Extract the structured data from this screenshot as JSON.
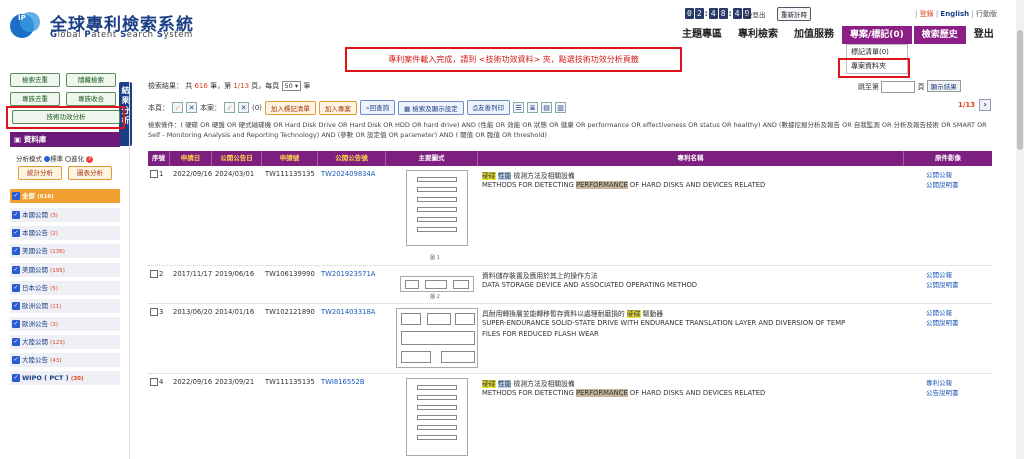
{
  "header": {
    "title_zh": "全球專利檢索系統",
    "title_en_words": [
      "G",
      "lobal ",
      "P",
      "atent ",
      "S",
      "earch ",
      "S",
      "ystem"
    ],
    "timer_digits": [
      "0",
      "2",
      "4",
      "8",
      "4",
      "9"
    ],
    "after_logout": "後登出",
    "reset_timer": "重新計時",
    "links": {
      "sep1": "|",
      "login": "登錄",
      "sep2": "|",
      "english": "English",
      "sep3": "|",
      "mobile": "行動版"
    }
  },
  "nav": {
    "items": [
      "主題專區",
      "專利檢索",
      "加值服務",
      "專案/標記(0)",
      "檢索歷史",
      "登出"
    ]
  },
  "dropdown": {
    "items": [
      "標記清單(0)",
      "專案資料夾"
    ]
  },
  "notice": "專利案件載入完成，請到 <技術功效資料> 夾，點選技術功效分析頁籤",
  "sidebar": {
    "buttons": [
      "檢索去重",
      "隱藏檢索",
      "專族去重",
      "專族收合"
    ],
    "tab_label": "結果分析",
    "tech_button": "技術功效分析",
    "db_title": "資料庫",
    "analysis_mode": {
      "label": "分析模式",
      "opt1": "標準",
      "opt2": "進化"
    },
    "stat_btn": "統計分析",
    "chart_btn": "圖表分析",
    "databases": [
      {
        "name": "全部",
        "count": "(616)"
      },
      {
        "name": "本國公開",
        "count": "(3)"
      },
      {
        "name": "本國公告",
        "count": "(2)"
      },
      {
        "name": "美國公告",
        "count": "(136)"
      },
      {
        "name": "美國公開",
        "count": "(195)"
      },
      {
        "name": "日本公告",
        "count": "(5)"
      },
      {
        "name": "歐洲公開",
        "count": "(11)"
      },
      {
        "name": "歐洲公告",
        "count": "(3)"
      },
      {
        "name": "大陸公開",
        "count": "(123)"
      },
      {
        "name": "大陸公告",
        "count": "(43)"
      },
      {
        "name": "WIPO ( PCT )",
        "count": "(30)"
      }
    ]
  },
  "results": {
    "prefix": "檢索結果：  共",
    "total": "616",
    "mid": "筆，第",
    "page": "1/13",
    "mid2": "頁，每頁",
    "per_page": "50",
    "suffix": "筆"
  },
  "goto": {
    "prefix": "跳至第",
    "suffix": "頁",
    "button": "顯示結果"
  },
  "toolbar": {
    "this_page": "本頁：",
    "this_case": "本案：",
    "count": "(0)",
    "add_mark": "加入標記清單",
    "add_project": "加入專案",
    "back_search": "回查詢",
    "settings": "檢索及顯示設定",
    "print": "友善列印"
  },
  "pager": {
    "text": "1/13"
  },
  "query": "檢索條件：( 硬碟 OR 硬盤 OR 硬式磁碟機 OR Hard Disk Drive OR Hard Disk OR HDD OR hard drive) AND (性能 OR 效能 OR 狀態 OR 健康 OR performance OR effectiveness OR status OR healthy) AND (數據挖掘分析及報告 OR 自我監測 OR 分析及報告技術 OR SMART OR Self - Monitoring Analysis and Reporting Technology) AND (參數 OR 設定值 OR parameter) AND ( 閾值 OR 臨值 OR threshold)",
  "table": {
    "headers": [
      "序號",
      "申請日",
      "公開公告日",
      "申請號",
      "公開公告號",
      "主要圖式",
      "專利名稱",
      "原件影像"
    ],
    "rows": [
      {
        "index": "1",
        "apply_date": "2022/09/16",
        "pub_date": "2024/03/01",
        "apply_no": "TW111135135",
        "pub_no": "TW202409834A",
        "title_zh_parts": [
          "硬碟",
          " ",
          "性能",
          " 檢測方法及相關設備"
        ],
        "title_en_parts": [
          "METHODS FOR DETECTING ",
          "PERFORMANCE",
          " OF HARD DISKS AND DEVICES RELATED"
        ],
        "images": [
          "公開公報",
          "公開說明書"
        ]
      },
      {
        "index": "2",
        "apply_date": "2017/11/17",
        "pub_date": "2019/06/16",
        "apply_no": "TW106139990",
        "pub_no": "TW201923571A",
        "title_zh_parts": [
          "資料儲存裝置及應用於其上的操作方法"
        ],
        "title_en_parts": [
          "DATA STORAGE DEVICE AND ASSOCIATED OPERATING METHOD"
        ],
        "images": [
          "公開公報",
          "公開說明書"
        ]
      },
      {
        "index": "3",
        "apply_date": "2013/06/20",
        "pub_date": "2014/01/16",
        "apply_no": "TW102121890",
        "pub_no": "TW201403318A",
        "title_zh_parts": [
          "具耐用轉換層並能轉移暫存資料以處理耐磨損的 ",
          "硬碟",
          " 驅動器"
        ],
        "title_en_parts": [
          "SUPER-ENDURANCE SOLID-STATE DRIVE WITH ENDURANCE TRANSLATION LAYER AND DIVERSION OF TEMP",
          "FILES FOR REDUCED FLASH WEAR"
        ],
        "images": [
          "公開公報",
          "公開說明書"
        ]
      },
      {
        "index": "4",
        "apply_date": "2022/09/16",
        "pub_date": "2023/09/21",
        "apply_no": "TW111135135",
        "pub_no": "TWI816552B",
        "title_zh_parts": [
          "硬碟",
          " ",
          "性能",
          " 檢測方法及相關設備"
        ],
        "title_en_parts": [
          "METHODS FOR DETECTING ",
          "PERFORMANCE",
          " OF HARD DISKS AND DEVICES RELATED"
        ],
        "images": [
          "專利公報",
          "公告說明書"
        ]
      }
    ],
    "thumb_captions": [
      "圖 1",
      "圖 2"
    ]
  },
  "colors": {
    "accent": "#7d1f7e",
    "alert": "#e0131a",
    "brand": "#1a3f87"
  }
}
